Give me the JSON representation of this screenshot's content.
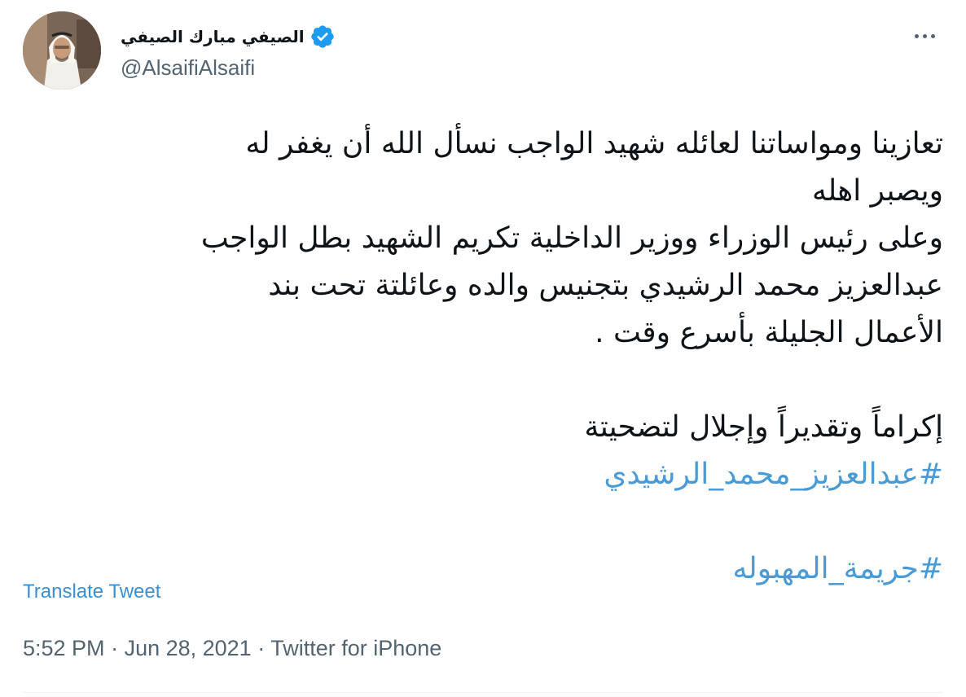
{
  "author": {
    "display_name": "الصيفي مبارك الصيفي",
    "handle": "@AlsaifiAlsaifi",
    "avatar_icon": "profile-photo",
    "verified_icon": "verified-badge-icon",
    "verified_color": "#1d9bf0"
  },
  "more_icon": "more-options-icon",
  "tweet": {
    "lines": [
      "تعازينا ومواساتنا لعائله شهيد الواجب نسأل الله أن يغفر له",
      "ويصبر اهله",
      "وعلى رئيس الوزراء ووزير الداخلية تكريم الشهيد بطل الواجب",
      "عبدالعزيز محمد الرشيدي بتجنيس والده وعائلتة تحت بند",
      "الأعمال الجليلة بأسرع وقت .",
      "إكراماً وتقديراً وإجلال لتضحيتة"
    ],
    "hashtags": [
      "#عبدالعزيز_محمد_الرشيدي",
      "#جريمة_المهبوله"
    ],
    "hashtag_color": "#1d9bf0"
  },
  "translate_label": "Translate Tweet",
  "meta": {
    "time": "5:52 PM",
    "separator": " · ",
    "date": "Jun 28, 2021",
    "source": "Twitter for iPhone"
  }
}
